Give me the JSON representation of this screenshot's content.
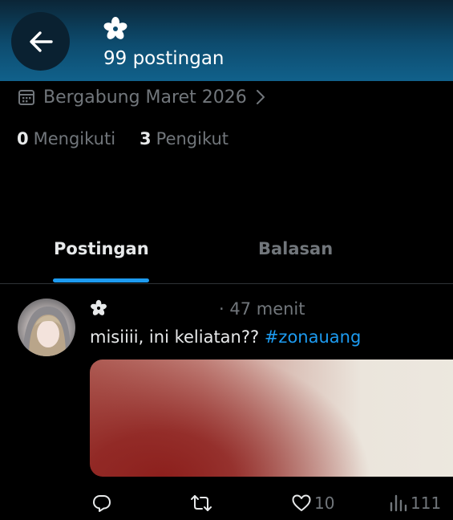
{
  "header": {
    "post_count": "99 postingan"
  },
  "profile": {
    "joined": "Bergabung Maret 2026",
    "following_count": "0",
    "following_label": "Mengikuti",
    "followers_count": "3",
    "followers_label": "Pengikut"
  },
  "tabs": [
    {
      "label": "Postingan",
      "active": true
    },
    {
      "label": "Balasan",
      "active": false
    }
  ],
  "post": {
    "time": "· 47 menit",
    "text": "misiiii, ini keliatan?? ",
    "hashtag": "#zonauang",
    "likes": "10",
    "views": "111"
  },
  "colors": {
    "accent": "#1d9bf0",
    "header_bg": "#0d4c6f",
    "muted_text": "#71767b"
  },
  "icons": [
    "back-arrow-icon",
    "flower-icon",
    "calendar-icon",
    "chevron-right-icon",
    "reply-icon",
    "repost-icon",
    "like-icon",
    "views-icon"
  ]
}
